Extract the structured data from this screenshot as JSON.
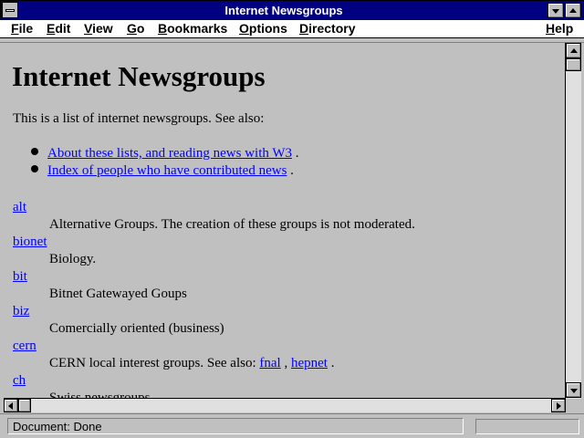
{
  "window": {
    "title": "Internet Newsgroups"
  },
  "menu": [
    {
      "label": "File",
      "mnemonic": "F",
      "rest": "ile"
    },
    {
      "label": "Edit",
      "mnemonic": "E",
      "rest": "dit"
    },
    {
      "label": "View",
      "mnemonic": "V",
      "rest": "iew"
    },
    {
      "label": "Go",
      "mnemonic": "G",
      "rest": "o"
    },
    {
      "label": "Bookmarks",
      "mnemonic": "B",
      "rest": "ookmarks"
    },
    {
      "label": "Options",
      "mnemonic": "O",
      "rest": "ptions"
    },
    {
      "label": "Directory",
      "mnemonic": "D",
      "rest": "irectory"
    },
    {
      "label": "Help",
      "mnemonic": "H",
      "rest": "elp"
    }
  ],
  "page": {
    "heading": "Internet Newsgroups",
    "intro": "This is a list of internet newsgroups. See also:",
    "see_also": [
      {
        "link": "About these lists, and reading news with W3",
        "suffix": " ."
      },
      {
        "link": "Index of people who have contributed news",
        "suffix": " ."
      }
    ],
    "groups": [
      {
        "name": "alt",
        "desc": "Alternative Groups. The creation of these groups is not moderated."
      },
      {
        "name": "bionet",
        "desc": "Biology."
      },
      {
        "name": "bit",
        "desc": "Bitnet Gatewayed Goups"
      },
      {
        "name": "biz",
        "desc": "Comercially oriented (business)"
      },
      {
        "name": "cern",
        "desc_prefix": "CERN local interest groups. See also: ",
        "links": [
          "fnal",
          "hepnet"
        ],
        "link_sep": " , ",
        "desc_suffix": " ."
      },
      {
        "name": "ch",
        "desc": "Swiss newsgroups"
      }
    ]
  },
  "status": {
    "text": "Document: Done"
  }
}
